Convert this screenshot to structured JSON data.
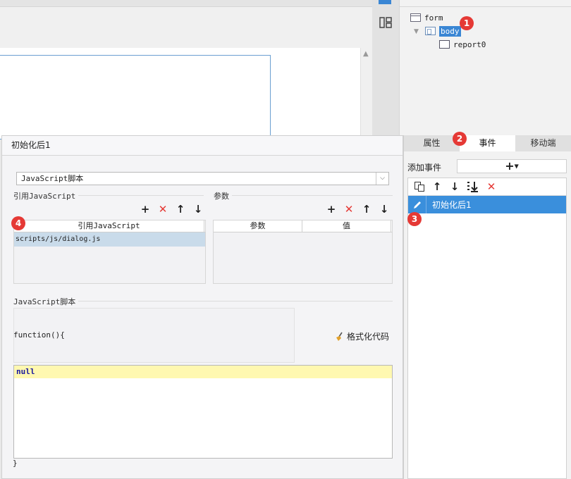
{
  "tree": {
    "nodes": [
      "form",
      "body",
      "report0"
    ]
  },
  "badges": [
    "1",
    "2",
    "3",
    "4"
  ],
  "dialog": {
    "title": "初始化后1",
    "script_type": "JavaScript脚本",
    "ref_section": "引用JavaScript",
    "param_section": "参数",
    "ref_table_header": "引用JavaScript",
    "ref_table_rows": [
      "scripts/js/dialog.js"
    ],
    "param_headers": [
      "参数",
      "值"
    ],
    "script_section": "JavaScript脚本",
    "func_header": "function(){",
    "code": "null",
    "func_footer": "}",
    "format_label": "格式化代码"
  },
  "right_panel": {
    "tabs": [
      "属性",
      "事件",
      "移动端"
    ],
    "active_tab": "事件",
    "add_event_label": "添加事件",
    "event_items": [
      "初始化后1"
    ]
  },
  "colors": {
    "accent": "#3a8fdc",
    "badge": "#e53935",
    "delete": "#e53935",
    "code_highlight": "#fff8b0"
  },
  "icons": [
    "layout-icon",
    "form-icon",
    "body-icon",
    "report-icon",
    "add-icon",
    "delete-icon",
    "up-arrow-icon",
    "down-arrow-icon",
    "copy-icon",
    "move-bottom-icon",
    "pencil-icon",
    "broom-icon",
    "dropdown-caret-icon"
  ]
}
